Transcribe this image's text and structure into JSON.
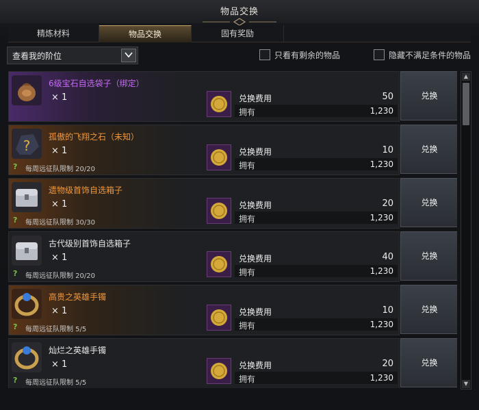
{
  "window": {
    "title": "物品交换"
  },
  "tabs": [
    {
      "label": "精炼材料",
      "active": false
    },
    {
      "label": "物品交换",
      "active": true
    },
    {
      "label": "固有奖励",
      "active": false
    }
  ],
  "filter": {
    "dropdown_label": "查看我的阶位",
    "dropdown_icon": "chevron-down",
    "check1_label": "只看有剩余的物品",
    "check2_label": "隐藏不满足条件的物品"
  },
  "common": {
    "cost_label": "兑换费用",
    "have_label": "拥有",
    "button_label": "兑换"
  },
  "items": [
    {
      "name": "6级宝石自选袋子（绑定）",
      "name_color": "#c46cf0",
      "qty": "× 1",
      "limit": "",
      "cost": "50",
      "have": "1,230",
      "icon": "pouch-icon"
    },
    {
      "name": "孤傲的飞翔之石（未知）",
      "name_color": "#f0973c",
      "qty": "× 1",
      "limit": "每周远征队限制 20/20",
      "cost": "10",
      "have": "1,230",
      "icon": "stone-icon"
    },
    {
      "name": "遗物级首饰自选箱子",
      "name_color": "#f0973c",
      "qty": "× 1",
      "limit": "每周远征队限制 30/30",
      "cost": "20",
      "have": "1,230",
      "icon": "chest-icon"
    },
    {
      "name": "古代级别首饰自选箱子",
      "name_color": "#e8e8e8",
      "qty": "× 1",
      "limit": "每周远征队限制 20/20",
      "cost": "40",
      "have": "1,230",
      "icon": "chest-icon"
    },
    {
      "name": "高贵之英雄手镯",
      "name_color": "#f0973c",
      "qty": "× 1",
      "limit": "每周远征队限制 5/5",
      "cost": "10",
      "have": "1,230",
      "icon": "bracelet-icon"
    },
    {
      "name": "灿烂之英雄手镯",
      "name_color": "#e8e8e8",
      "qty": "× 1",
      "limit": "每周远征队限制 5/5",
      "cost": "20",
      "have": "1,230",
      "icon": "bracelet-icon"
    }
  ]
}
